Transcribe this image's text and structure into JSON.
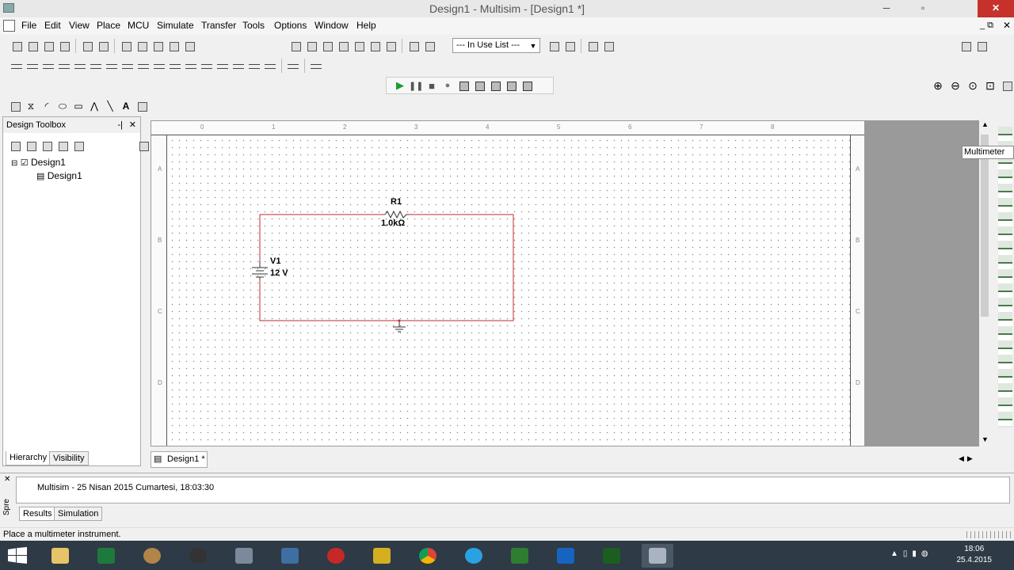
{
  "window": {
    "title": "Design1 - Multisim - [Design1 *]",
    "minimize": "─",
    "maximize": "▫",
    "close": "✕"
  },
  "menu": [
    "File",
    "Edit",
    "View",
    "Place",
    "MCU",
    "Simulate",
    "Transfer",
    "Tools",
    "Options",
    "Window",
    "Help"
  ],
  "toolbar": {
    "in_use_list": "--- In Use List ---"
  },
  "design_toolbox": {
    "title": "Design Toolbox",
    "tree": [
      {
        "label": "Design1"
      },
      {
        "label": "Design1"
      }
    ],
    "tabs": [
      "Hierarchy",
      "Visibility"
    ]
  },
  "schematic": {
    "ruler_columns": [
      "0",
      "1",
      "2",
      "3",
      "4",
      "5",
      "6",
      "7",
      "8"
    ],
    "ruler_rows": [
      "A",
      "B",
      "C",
      "D"
    ],
    "resistor": {
      "ref": "R1",
      "value": "1.0kΩ"
    },
    "source": {
      "ref": "V1",
      "value": "12 V"
    },
    "wire_color": "#c0282d"
  },
  "tooltip": "Multimeter",
  "document_tab": "Design1 *",
  "output": {
    "message": "Multisim  -  25 Nisan 2015 Cumartesi, 18:03:30",
    "tabs": [
      "Results",
      "Simulation"
    ],
    "side_label": "Spre"
  },
  "status": "Place a multimeter instrument.",
  "taskbar": {
    "time": "18:06",
    "date": "25.4.2015"
  }
}
